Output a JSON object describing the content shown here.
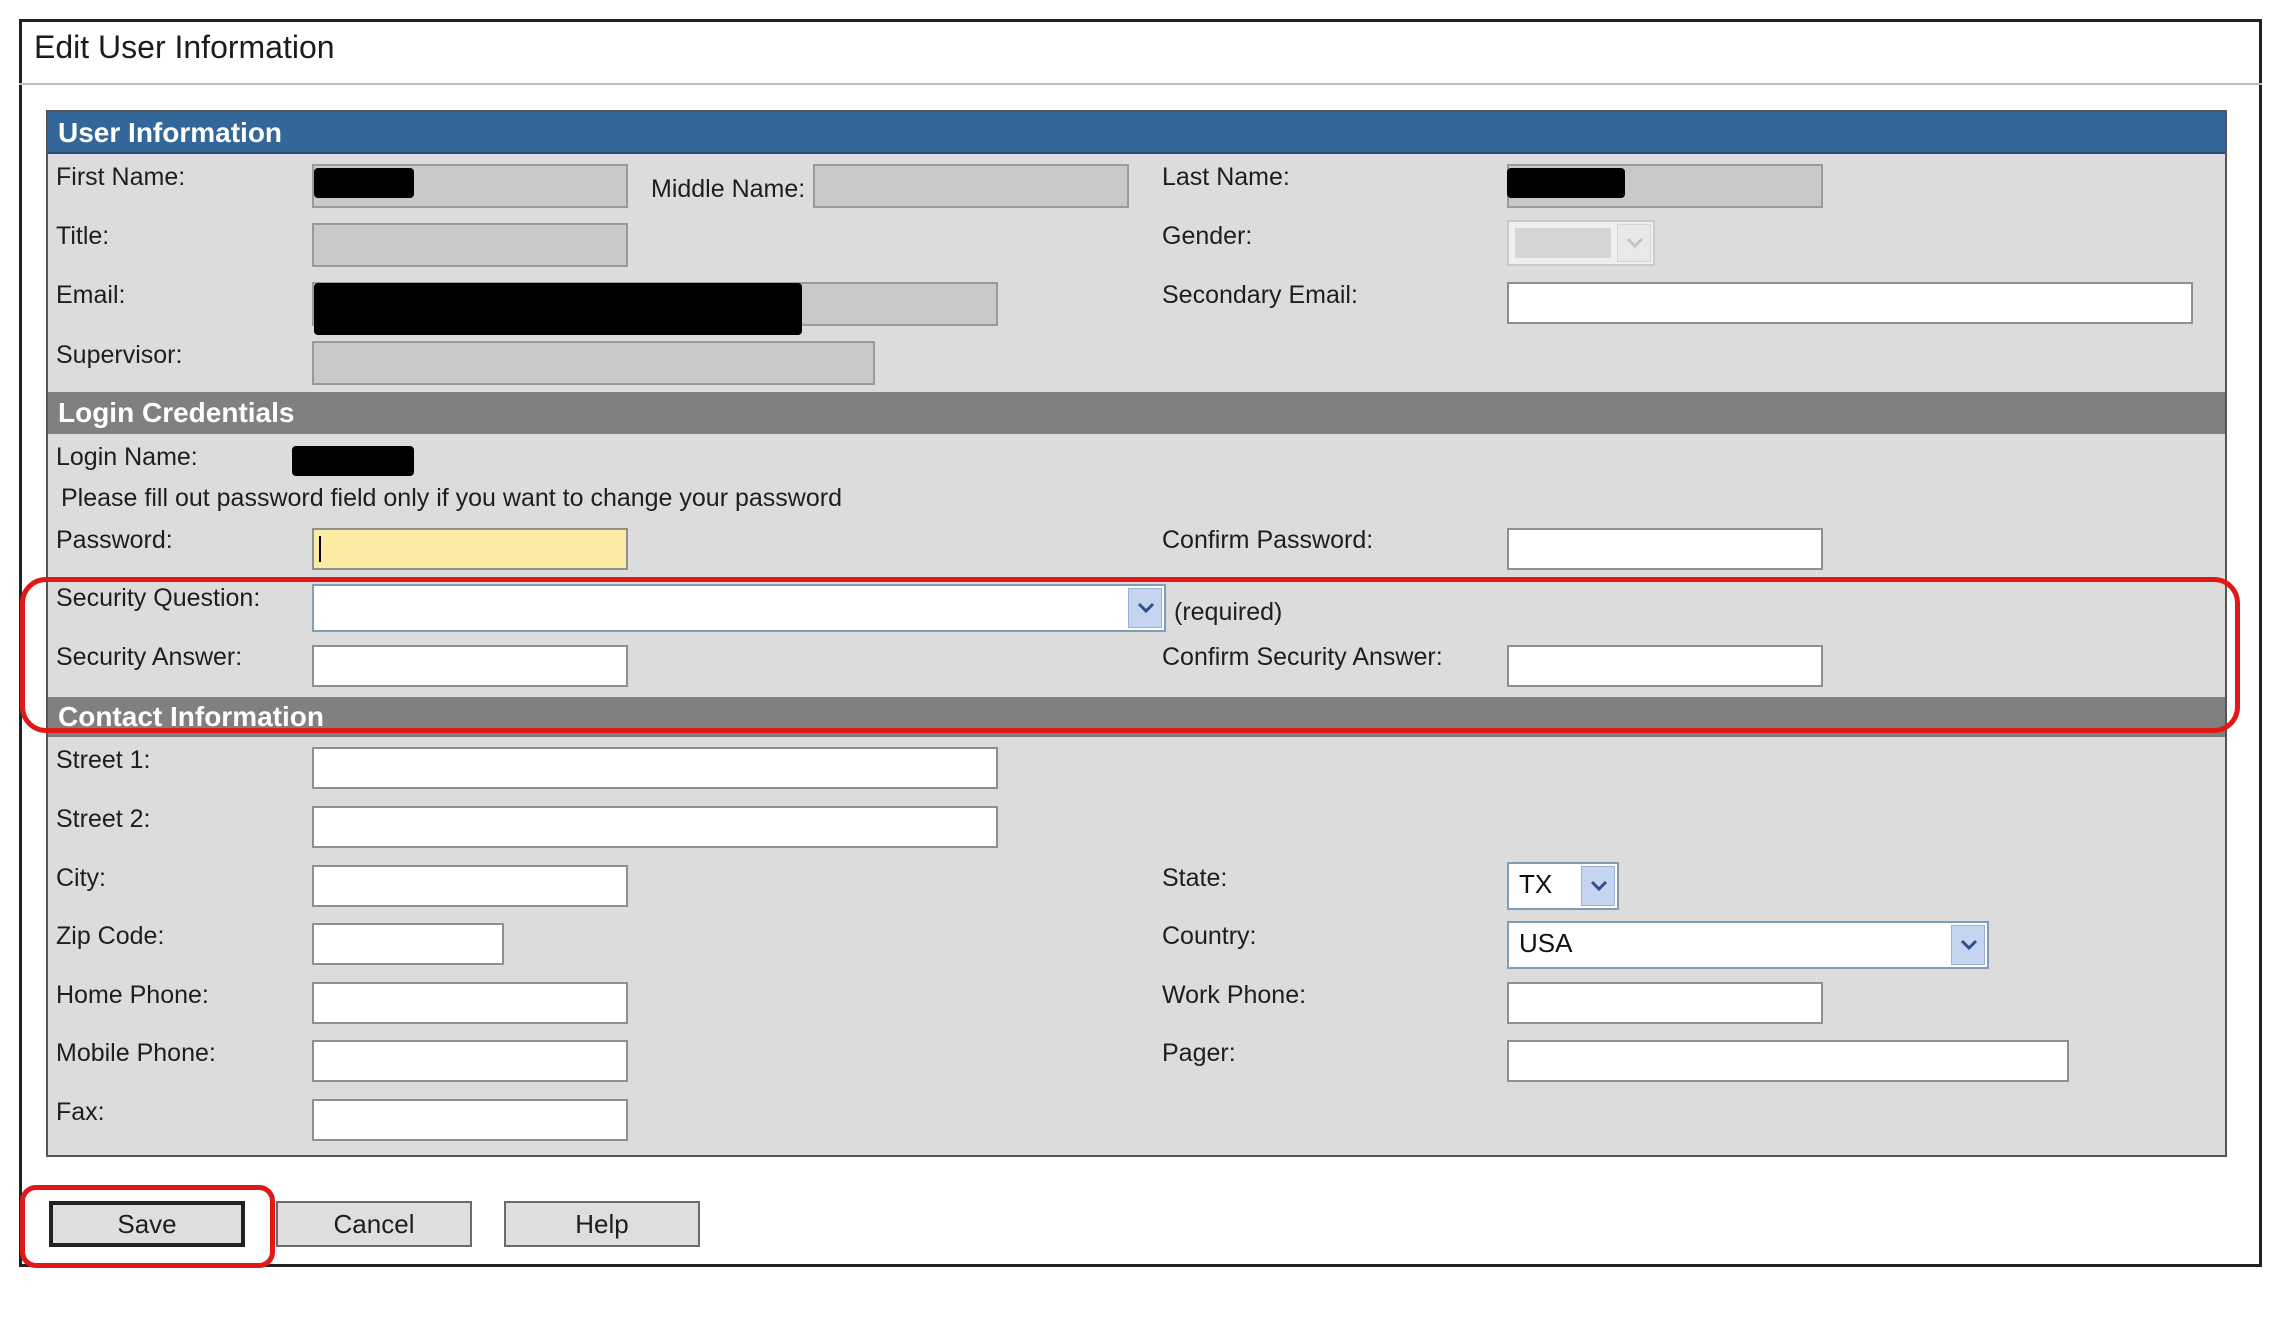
{
  "window": {
    "title": "Edit User Information"
  },
  "sections": {
    "user_info": "User Information",
    "login": "Login Credentials",
    "contact": "Contact Information"
  },
  "user_info": {
    "first_name_label": "First Name:",
    "middle_name_label": "Middle Name:",
    "last_name_label": "Last Name:",
    "title_label": "Title:",
    "gender_label": "Gender:",
    "email_label": "Email:",
    "secondary_email_label": "Secondary Email:",
    "supervisor_label": "Supervisor:"
  },
  "login": {
    "login_name_label": "Login Name:",
    "password_note": "Please fill out password field only if you want to change your password",
    "password_label": "Password:",
    "confirm_password_label": "Confirm Password:",
    "security_question_label": "Security Question:",
    "security_question_value": "",
    "required_text": "(required)",
    "security_answer_label": "Security Answer:",
    "confirm_security_answer_label": "Confirm Security Answer:"
  },
  "contact": {
    "street1_label": "Street 1:",
    "street2_label": "Street 2:",
    "city_label": "City:",
    "state_label": "State:",
    "state_value": "TX",
    "zip_label": "Zip Code:",
    "country_label": "Country:",
    "country_value": "USA",
    "home_phone_label": "Home Phone:",
    "work_phone_label": "Work Phone:",
    "mobile_phone_label": "Mobile Phone:",
    "pager_label": "Pager:",
    "fax_label": "Fax:"
  },
  "buttons": {
    "save": "Save",
    "cancel": "Cancel",
    "help": "Help"
  },
  "colors": {
    "section_blue": "#336699",
    "section_gray": "#808080",
    "panel_bg": "#dcdcdc",
    "active_field": "#fbeba3",
    "highlight": "#e01818"
  },
  "icons": {
    "dropdown": "chevron-down-icon"
  }
}
